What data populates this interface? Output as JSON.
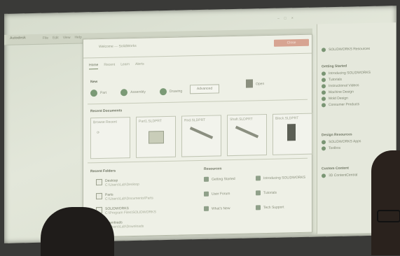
{
  "app": {
    "logo": "Autodesk",
    "menu": [
      "File",
      "Edit",
      "View",
      "Help"
    ]
  },
  "dialog": {
    "title": "Welcome — SolidWorks",
    "close_label": "Close",
    "tabs": [
      "Home",
      "Recent",
      "Learn",
      "Alerts"
    ],
    "new_label": "New",
    "new_items": [
      "Part",
      "Assembly",
      "Drawing"
    ],
    "open_button": "Advanced",
    "open_label": "Open",
    "recent_docs_label": "Recent Documents",
    "recent_docs": [
      "Browse Recent",
      "Part1.SLDPRT",
      "Rod.SLDPRT",
      "Shaft.SLDPRT",
      "Block.SLDPRT"
    ],
    "recent_folders_label": "Recent Folders",
    "recent_folders": [
      {
        "name": "Desktop",
        "path": "C:\\Users\\Lab\\Desktop"
      },
      {
        "name": "Parts",
        "path": "C:\\Users\\Lab\\Documents\\Parts"
      },
      {
        "name": "SOLIDWORKS",
        "path": "C:\\Program Files\\SOLIDWORKS"
      },
      {
        "name": "Downloads",
        "path": "C:\\Users\\Lab\\Downloads"
      }
    ],
    "resources_label": "Resources",
    "resources": [
      "Getting Started",
      "Introducing SOLIDWORKS",
      "User Forum",
      "Tutorials",
      "What's New",
      "Tech Support"
    ]
  },
  "sidebar": {
    "title": "SOLIDWORKS Resources",
    "groups": [
      {
        "head": "Getting Started",
        "items": [
          "Introducing SOLIDWORKS",
          "Tutorials",
          "Instructional Videos",
          "Machine Design",
          "Mold Design",
          "Consumer Products"
        ]
      },
      {
        "head": "Design Resources",
        "items": [
          "SOLIDWORKS Apps",
          "Toolbox"
        ]
      },
      {
        "head": "Custom Content",
        "items": [
          "3D ContentCentral"
        ]
      }
    ]
  }
}
